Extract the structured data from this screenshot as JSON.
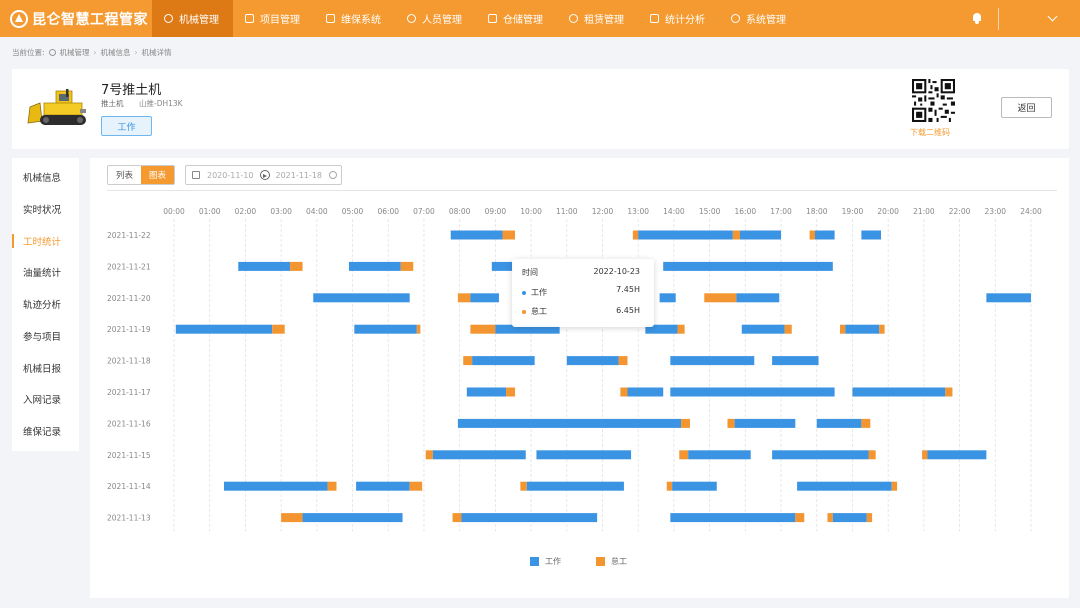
{
  "app": {
    "title": "昆仑智慧工程管家"
  },
  "nav": [
    {
      "label": "机械管理",
      "icon": "gear-icon",
      "active": true
    },
    {
      "label": "项目管理",
      "icon": "project-icon",
      "active": false
    },
    {
      "label": "维保系统",
      "icon": "maintenance-icon",
      "active": false
    },
    {
      "label": "人员管理",
      "icon": "person-icon",
      "active": false
    },
    {
      "label": "仓储管理",
      "icon": "warehouse-icon",
      "active": false
    },
    {
      "label": "租赁管理",
      "icon": "lease-icon",
      "active": false
    },
    {
      "label": "统计分析",
      "icon": "chart-icon",
      "active": false
    },
    {
      "label": "系统管理",
      "icon": "settings-icon",
      "active": false
    }
  ],
  "breadcrumb": {
    "prefix": "当前位置:",
    "items": [
      "机械管理",
      "机械信息",
      "机械详情"
    ]
  },
  "machine": {
    "name": "7号推土机",
    "type": "推土机",
    "model": "山推-DH13K",
    "status": "工作",
    "qr_label": "下载二维码",
    "back_label": "返回"
  },
  "sidebar": {
    "items": [
      "机械信息",
      "实时状况",
      "工时统计",
      "油量统计",
      "轨迹分析",
      "参与项目",
      "机械日报",
      "入网记录",
      "维保记录"
    ],
    "active_index": 2
  },
  "view_toggle": {
    "list": "列表",
    "chart": "图表",
    "active": "chart"
  },
  "date_range": {
    "start": "2020-11-10",
    "end": "2021-11-18"
  },
  "colors": {
    "work": "#3b93e3",
    "idle": "#f39631",
    "accent": "#f59a30"
  },
  "tooltip": {
    "title_label": "时间",
    "date": "2022-10-23",
    "rows": [
      {
        "label": "工作",
        "value": "7.45H",
        "color": "#3b93e3"
      },
      {
        "label": "怠工",
        "value": "6.45H",
        "color": "#f39631"
      }
    ]
  },
  "chart_data": {
    "type": "gantt",
    "x_ticks": [
      "00:00",
      "01:00",
      "02:00",
      "03:00",
      "04:00",
      "05:00",
      "06:00",
      "07:00",
      "08:00",
      "09:00",
      "10:00",
      "11:00",
      "12:00",
      "13:00",
      "14:00",
      "15:00",
      "16:00",
      "17:00",
      "18:00",
      "19:00",
      "20:00",
      "21:00",
      "22:00",
      "23:00",
      "24:00"
    ],
    "x_range": [
      0,
      24
    ],
    "categories": [
      "2021-11-22",
      "2021-11-21",
      "2021-11-20",
      "2021-11-19",
      "2021-11-18",
      "2021-11-17",
      "2021-11-16",
      "2021-11-15",
      "2021-11-14",
      "2021-11-13"
    ],
    "legend": [
      "工作",
      "怠工"
    ],
    "grid": true,
    "rows": [
      {
        "date": "2021-11-22",
        "segments": [
          [
            7.75,
            9.2,
            "work"
          ],
          [
            9.2,
            9.55,
            "idle"
          ],
          [
            12.85,
            13.0,
            "idle"
          ],
          [
            13.0,
            15.65,
            "work"
          ],
          [
            15.65,
            15.85,
            "idle"
          ],
          [
            15.85,
            17.0,
            "work"
          ],
          [
            17.8,
            17.95,
            "idle"
          ],
          [
            17.95,
            18.5,
            "work"
          ],
          [
            19.25,
            19.8,
            "work"
          ]
        ]
      },
      {
        "date": "2021-11-21",
        "segments": [
          [
            1.8,
            3.25,
            "work"
          ],
          [
            3.25,
            3.6,
            "idle"
          ],
          [
            4.9,
            6.35,
            "work"
          ],
          [
            6.35,
            6.7,
            "idle"
          ],
          [
            8.9,
            9.5,
            "work"
          ],
          [
            13.7,
            18.45,
            "work"
          ]
        ]
      },
      {
        "date": "2021-11-20",
        "segments": [
          [
            3.9,
            6.6,
            "work"
          ],
          [
            7.95,
            8.3,
            "idle"
          ],
          [
            8.3,
            9.1,
            "work"
          ],
          [
            13.6,
            14.05,
            "work"
          ],
          [
            14.85,
            15.75,
            "idle"
          ],
          [
            15.75,
            16.95,
            "work"
          ],
          [
            22.75,
            24.0,
            "work"
          ]
        ]
      },
      {
        "date": "2021-11-19",
        "segments": [
          [
            0.05,
            2.75,
            "work"
          ],
          [
            2.75,
            3.1,
            "idle"
          ],
          [
            5.05,
            6.8,
            "work"
          ],
          [
            6.8,
            6.9,
            "idle"
          ],
          [
            8.3,
            9.0,
            "idle"
          ],
          [
            9.0,
            10.8,
            "work"
          ],
          [
            13.2,
            14.1,
            "work"
          ],
          [
            14.1,
            14.3,
            "idle"
          ],
          [
            15.9,
            17.1,
            "work"
          ],
          [
            17.1,
            17.3,
            "idle"
          ],
          [
            18.65,
            18.8,
            "idle"
          ],
          [
            18.8,
            19.75,
            "work"
          ],
          [
            19.75,
            19.9,
            "idle"
          ]
        ]
      },
      {
        "date": "2021-11-18",
        "segments": [
          [
            8.1,
            8.35,
            "idle"
          ],
          [
            8.35,
            10.1,
            "work"
          ],
          [
            11.0,
            12.45,
            "work"
          ],
          [
            12.45,
            12.7,
            "idle"
          ],
          [
            13.9,
            16.25,
            "work"
          ],
          [
            16.75,
            18.05,
            "work"
          ]
        ]
      },
      {
        "date": "2021-11-17",
        "segments": [
          [
            8.2,
            9.3,
            "work"
          ],
          [
            9.3,
            9.55,
            "idle"
          ],
          [
            12.5,
            12.7,
            "idle"
          ],
          [
            12.7,
            13.7,
            "work"
          ],
          [
            13.9,
            18.5,
            "work"
          ],
          [
            19.0,
            21.6,
            "work"
          ],
          [
            21.6,
            21.8,
            "idle"
          ]
        ]
      },
      {
        "date": "2021-11-16",
        "segments": [
          [
            7.95,
            14.2,
            "work"
          ],
          [
            14.2,
            14.45,
            "idle"
          ],
          [
            15.5,
            15.7,
            "idle"
          ],
          [
            15.7,
            17.4,
            "work"
          ],
          [
            18.0,
            19.25,
            "work"
          ],
          [
            19.25,
            19.5,
            "idle"
          ]
        ]
      },
      {
        "date": "2021-11-15",
        "segments": [
          [
            7.05,
            7.25,
            "idle"
          ],
          [
            7.25,
            9.85,
            "work"
          ],
          [
            10.15,
            12.8,
            "work"
          ],
          [
            14.15,
            14.4,
            "idle"
          ],
          [
            14.4,
            16.15,
            "work"
          ],
          [
            16.75,
            19.45,
            "work"
          ],
          [
            19.45,
            19.65,
            "idle"
          ],
          [
            20.95,
            21.1,
            "idle"
          ],
          [
            21.1,
            22.75,
            "work"
          ]
        ]
      },
      {
        "date": "2021-11-14",
        "segments": [
          [
            1.4,
            4.3,
            "work"
          ],
          [
            4.3,
            4.55,
            "idle"
          ],
          [
            5.1,
            6.6,
            "work"
          ],
          [
            6.6,
            6.95,
            "idle"
          ],
          [
            9.7,
            9.88,
            "idle"
          ],
          [
            9.88,
            12.6,
            "work"
          ],
          [
            13.8,
            13.95,
            "idle"
          ],
          [
            13.95,
            15.2,
            "work"
          ],
          [
            17.45,
            20.1,
            "work"
          ],
          [
            20.1,
            20.25,
            "idle"
          ]
        ]
      },
      {
        "date": "2021-11-13",
        "segments": [
          [
            3.0,
            3.6,
            "idle"
          ],
          [
            3.6,
            6.4,
            "work"
          ],
          [
            7.8,
            8.05,
            "idle"
          ],
          [
            8.05,
            11.85,
            "work"
          ],
          [
            13.9,
            17.4,
            "work"
          ],
          [
            17.4,
            17.65,
            "idle"
          ],
          [
            18.3,
            18.45,
            "idle"
          ],
          [
            18.45,
            19.4,
            "work"
          ],
          [
            19.4,
            19.55,
            "idle"
          ]
        ]
      }
    ]
  }
}
